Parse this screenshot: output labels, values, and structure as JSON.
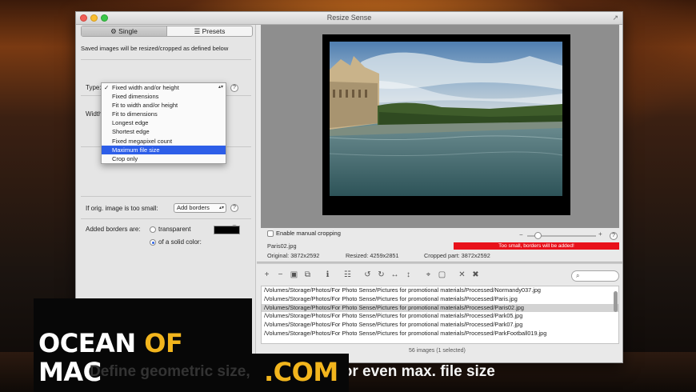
{
  "window": {
    "title": "Resize Sense"
  },
  "tabs": [
    {
      "label": "Single"
    },
    {
      "label": "Presets"
    }
  ],
  "left": {
    "saved_note": "Saved images will be resized/cropped as defined below",
    "type_label": "Type:",
    "type_value": "Fixed width and/or height",
    "width_label": "Width",
    "type_options": [
      "Fixed width and/or height",
      "Fixed dimensions",
      "Fit to width and/or height",
      "Fit to dimensions",
      "Longest edge",
      "Shortest edge",
      "Fixed megapixel count",
      "Maximum file size",
      "Crop only"
    ],
    "too_small_label": "If orig. image is too small:",
    "too_small_value": "Add borders",
    "borders_label": "Added borders are:",
    "transparent_label": "transparent",
    "solid_color_label": "of a solid color:",
    "help": "?"
  },
  "right": {
    "manual_crop_label": "Enable manual cropping",
    "warning": "Too small, borders will be added!",
    "filename": "Paris02.jpg",
    "original": "Original: 3872x2592",
    "resized": "Resized: 4259x2851",
    "cropped": "Cropped part: 3872x2592",
    "slider_minus": "−",
    "slider_plus": "+",
    "zoom_level": 0.12,
    "files": [
      "/Volumes/Storage/Photos/For Photo Sense/Pictures for promotional materials/Processed/Normandy037.jpg",
      "/Volumes/Storage/Photos/For Photo Sense/Pictures for promotional materials/Processed/Paris.jpg",
      "/Volumes/Storage/Photos/For Photo Sense/Pictures for promotional materials/Processed/Paris02.jpg",
      "/Volumes/Storage/Photos/For Photo Sense/Pictures for promotional materials/Processed/Park05.jpg",
      "/Volumes/Storage/Photos/For Photo Sense/Pictures for promotional materials/Processed/Park07.jpg",
      "/Volumes/Storage/Photos/For Photo Sense/Pictures for promotional materials/Processed/ParkFootball019.jpg"
    ],
    "images_count": "56 images (1 selected)"
  },
  "watermark": {
    "ocean": "OCEAN ",
    "of": "OF",
    "mac": " MAC",
    "com": ".COM"
  },
  "caption": {
    "part1": "Define geometric size, pi",
    "part2": "xel count, or even max. file size"
  },
  "colors": {
    "selection": "#2d5ee8",
    "warning": "#e8111a",
    "accent_gold": "#f2b51d"
  }
}
